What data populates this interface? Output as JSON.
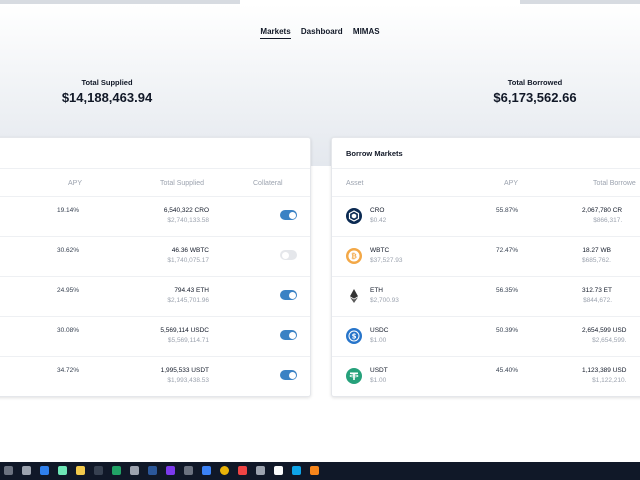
{
  "nav": {
    "items": [
      "Markets",
      "Dashboard",
      "MIMAS"
    ],
    "active": "Markets"
  },
  "stats": {
    "total_supplied_label": "Total Supplied",
    "total_supplied_value": "$14,188,463.94",
    "total_borrowed_label": "Total Borrowed",
    "total_borrowed_value": "$6,173,562.66"
  },
  "supply": {
    "headers": {
      "apy": "APY",
      "total_supplied": "Total Supplied",
      "collateral": "Collateral"
    },
    "rows": [
      {
        "apy": "19.14%",
        "amount": "6,540,322 CRO",
        "usd": "$2,740,133.58",
        "collateral": true
      },
      {
        "apy": "30.62%",
        "amount": "46.36 WBTC",
        "usd": "$1,740,075.17",
        "collateral": false
      },
      {
        "apy": "24.95%",
        "amount": "794.43 ETH",
        "usd": "$2,145,701.96",
        "collateral": true
      },
      {
        "apy": "30.08%",
        "amount": "5,569,114 USDC",
        "usd": "$5,569,114.71",
        "collateral": true
      },
      {
        "apy": "34.72%",
        "amount": "1,995,533 USDT",
        "usd": "$1,993,438.53",
        "collateral": true
      }
    ]
  },
  "borrow": {
    "title": "Borrow Markets",
    "headers": {
      "asset": "Asset",
      "apy": "APY",
      "total_borrowed": "Total Borrowe"
    },
    "rows": [
      {
        "icon": "cro-icon",
        "asset": "CRO",
        "price": "$0.42",
        "apy": "55.87%",
        "amount": "2,067,780 CR",
        "usd": "$866,317."
      },
      {
        "icon": "wbtc-icon",
        "asset": "WBTC",
        "price": "$37,527.93",
        "apy": "72.47%",
        "amount": "18.27 WB",
        "usd": "$685,762."
      },
      {
        "icon": "eth-icon",
        "asset": "ETH",
        "price": "$2,700.93",
        "apy": "56.35%",
        "amount": "312.73 ET",
        "usd": "$844,672."
      },
      {
        "icon": "usdc-icon",
        "asset": "USDC",
        "price": "$1.00",
        "apy": "50.39%",
        "amount": "2,654,599 USD",
        "usd": "$2,654,599."
      },
      {
        "icon": "usdt-icon",
        "asset": "USDT",
        "price": "$1.00",
        "apy": "45.40%",
        "amount": "1,123,389 USD",
        "usd": "$1,122,210."
      }
    ]
  },
  "colors": {
    "toggle_on": "#3b82c4",
    "toggle_off": "#e5e7eb",
    "taskbar": "#101828"
  },
  "taskbar": {
    "icons": [
      "search-icon",
      "vscode-icon",
      "app-icon",
      "explorer-icon",
      "terminal-icon",
      "excel-icon",
      "notepad-icon",
      "word-icon",
      "app-icon",
      "app-icon",
      "app-icon",
      "chrome-icon",
      "app-icon",
      "app-icon",
      "app-icon",
      "app-icon",
      "app-icon",
      "metamask-icon"
    ]
  }
}
